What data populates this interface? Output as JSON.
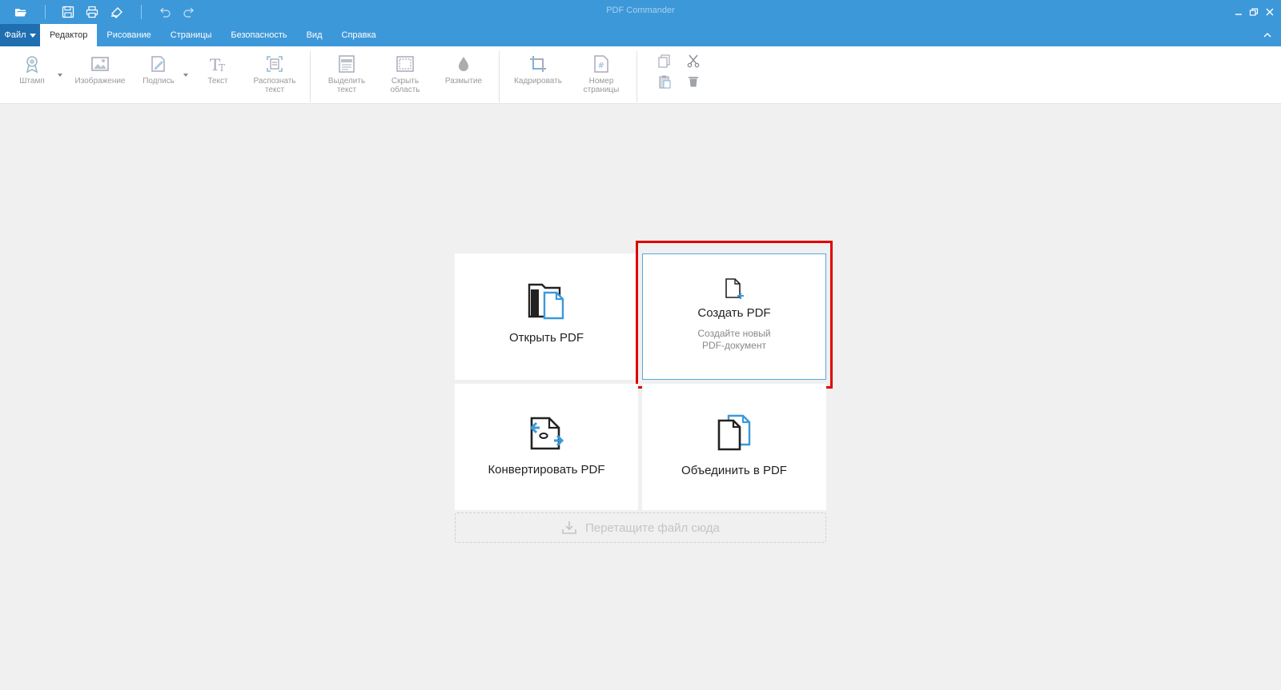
{
  "window": {
    "title": "PDF Commander",
    "colors": {
      "titlebar": "#3d98d9",
      "file_button": "#1f6eb0",
      "highlight": "#e00000",
      "accent": "#3b9ad9"
    }
  },
  "quick_access": {
    "icons": [
      "folder-open-icon",
      "save-icon",
      "print-icon",
      "scan-icon",
      "undo-icon",
      "redo-icon"
    ]
  },
  "menu": {
    "file_label": "Файл",
    "tabs": [
      {
        "label": "Редактор",
        "active": true
      },
      {
        "label": "Рисование",
        "active": false
      },
      {
        "label": "Страницы",
        "active": false
      },
      {
        "label": "Безопасность",
        "active": false
      },
      {
        "label": "Вид",
        "active": false
      },
      {
        "label": "Справка",
        "active": false
      }
    ]
  },
  "ribbon": {
    "stamp": "Штамп",
    "image": "Изображение",
    "signature": "Подпись",
    "text": "Текст",
    "ocr": "Распознать\nтекст",
    "select_text": "Выделить\nтекст",
    "hide_area": "Скрыть\nобласть",
    "blur": "Размытие",
    "crop": "Кадрировать",
    "page_number": "Номер\nстраницы",
    "clipboard_icons": [
      "copy-icon",
      "cut-icon",
      "paste-icon",
      "delete-icon"
    ]
  },
  "start": {
    "open": {
      "title": "Открыть PDF"
    },
    "create": {
      "title": "Создать PDF",
      "subtitle": "Создайте новый\nPDF-документ",
      "highlighted": true
    },
    "convert": {
      "title": "Конвертировать PDF"
    },
    "merge": {
      "title": "Объединить в PDF"
    },
    "dropzone": "Перетащите файл сюда"
  }
}
